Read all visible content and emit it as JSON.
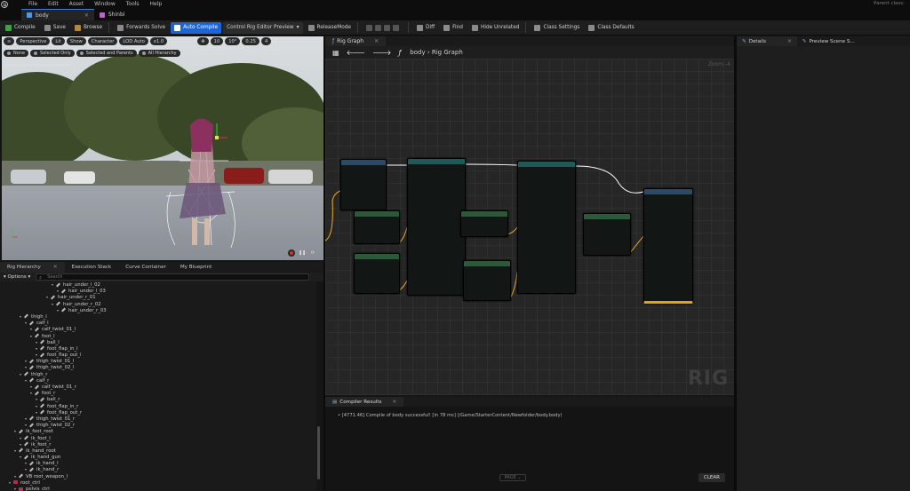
{
  "menubar": {
    "items": [
      "File",
      "Edit",
      "Asset",
      "Window",
      "Tools",
      "Help"
    ],
    "parent_class": "Parent class:"
  },
  "tabs": [
    {
      "label": "body",
      "color": "#4a9be8"
    },
    {
      "label": "Shinbi",
      "color": "#c060d0"
    }
  ],
  "toolbar": {
    "compile": "Compile",
    "save": "Save",
    "browse": "Browse",
    "forwards_solve": "Forwards Solve",
    "auto_compile": "Auto Compile",
    "preview": "Control Rig Editor Preview",
    "release_mode": "ReleaseMode",
    "diff": "Diff",
    "find": "Find",
    "hide_unrelated": "Hide Unrelated",
    "class_settings": "Class Settings",
    "class_defaults": "Class Defaults"
  },
  "viewport": {
    "pills": [
      "Perspective",
      "Lit",
      "Show",
      "Character",
      "LOD Auto",
      "x1.0"
    ],
    "numbers": [
      "10",
      "10°",
      "0.25",
      "4"
    ],
    "row2": [
      "None",
      "Selected Only",
      "Selected and Parents",
      "All Hierarchy"
    ],
    "preview_label": "Previewing Reference Pose"
  },
  "left_panel": {
    "tabs": [
      "Rig Hierarchy",
      "Execution Stack",
      "Curve Container",
      "My Blueprint"
    ],
    "options": "Options",
    "search_placeholder": "Search",
    "tree": [
      {
        "label": "hair_under_l_02",
        "indent": 9,
        "type": "bone"
      },
      {
        "label": "hair_under_l_03",
        "indent": 10,
        "type": "bone"
      },
      {
        "label": "hair_under_r_01",
        "indent": 8,
        "type": "bone"
      },
      {
        "label": "hair_under_r_02",
        "indent": 9,
        "type": "bone"
      },
      {
        "label": "hair_under_r_03",
        "indent": 10,
        "type": "bone"
      },
      {
        "label": "thigh_l",
        "indent": 3,
        "type": "bone"
      },
      {
        "label": "calf_l",
        "indent": 4,
        "type": "bone"
      },
      {
        "label": "calf_twist_01_l",
        "indent": 5,
        "type": "bone"
      },
      {
        "label": "foot_l",
        "indent": 5,
        "type": "bone"
      },
      {
        "label": "ball_l",
        "indent": 6,
        "type": "bone"
      },
      {
        "label": "foot_flap_in_l",
        "indent": 6,
        "type": "bone"
      },
      {
        "label": "foot_flap_out_l",
        "indent": 6,
        "type": "bone"
      },
      {
        "label": "thigh_twist_01_l",
        "indent": 4,
        "type": "bone"
      },
      {
        "label": "thigh_twist_02_l",
        "indent": 4,
        "type": "bone"
      },
      {
        "label": "thigh_r",
        "indent": 3,
        "type": "bone"
      },
      {
        "label": "calf_r",
        "indent": 4,
        "type": "bone"
      },
      {
        "label": "calf_twist_01_r",
        "indent": 5,
        "type": "bone"
      },
      {
        "label": "foot_r",
        "indent": 5,
        "type": "bone"
      },
      {
        "label": "ball_r",
        "indent": 6,
        "type": "bone"
      },
      {
        "label": "foot_flap_in_r",
        "indent": 6,
        "type": "bone"
      },
      {
        "label": "foot_flap_out_r",
        "indent": 6,
        "type": "bone"
      },
      {
        "label": "thigh_twist_01_r",
        "indent": 4,
        "type": "bone"
      },
      {
        "label": "thigh_twist_02_r",
        "indent": 4,
        "type": "bone"
      },
      {
        "label": "ik_foot_root",
        "indent": 2,
        "type": "bone"
      },
      {
        "label": "ik_foot_l",
        "indent": 3,
        "type": "bone"
      },
      {
        "label": "ik_foot_r",
        "indent": 3,
        "type": "bone"
      },
      {
        "label": "ik_hand_root",
        "indent": 2,
        "type": "bone"
      },
      {
        "label": "ik_hand_gun",
        "indent": 3,
        "type": "bone"
      },
      {
        "label": "ik_hand_l",
        "indent": 4,
        "type": "bone"
      },
      {
        "label": "ik_hand_r",
        "indent": 4,
        "type": "bone"
      },
      {
        "label": "VB root_weapon_l",
        "indent": 2,
        "type": "bone"
      },
      {
        "label": "root_ctrl",
        "indent": 1,
        "type": "ctrl"
      },
      {
        "label": "pelvis_ctrl",
        "indent": 2,
        "type": "ctrl"
      },
      {
        "label": "spine_01_ctrl",
        "indent": 3,
        "type": "ctrl-yellow"
      },
      {
        "label": "spine_02_ctrl",
        "indent": 4,
        "type": "ctrl-yellow"
      },
      {
        "label": "spine_03_ctrl",
        "indent": 5,
        "type": "ctrl-yellow"
      }
    ]
  },
  "graph": {
    "tab": "Rig Graph",
    "breadcrumb": "body › Rig Graph",
    "zoom": "Zoom -4",
    "watermark": "RIG"
  },
  "compiler": {
    "tab": "Compiler Results",
    "message": "• [4771.46] Compile of body successful! [in 78 ms] (/Game/StarterContent/Newfolder/body.body)",
    "page": "PAGE ⌄",
    "clear": "CLEAR"
  },
  "right_panel": {
    "tabs": [
      "Details",
      "Preview Scene S..."
    ]
  }
}
